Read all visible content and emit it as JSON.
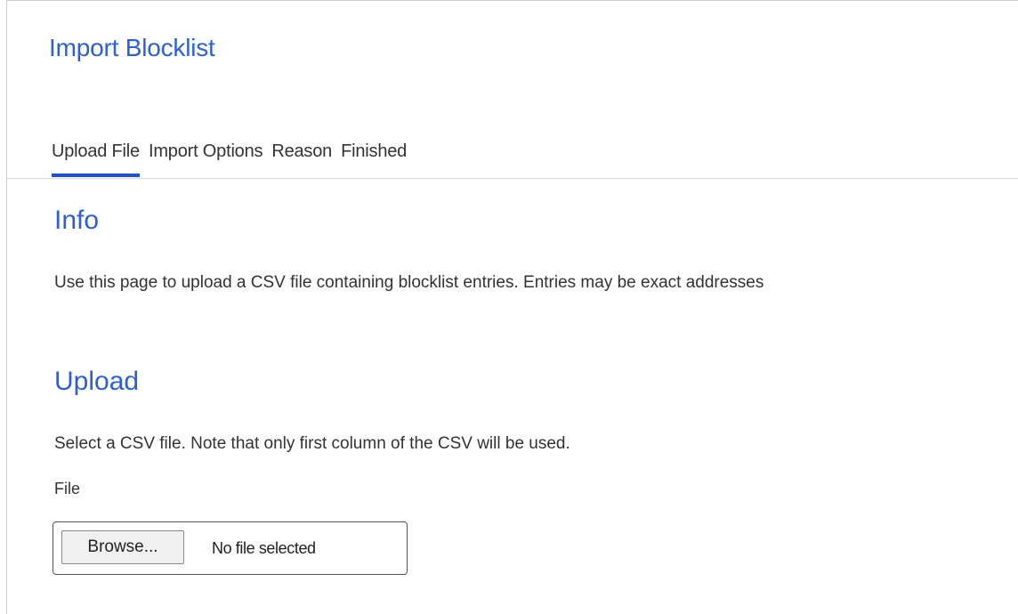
{
  "page": {
    "title": "Import Blocklist"
  },
  "tabs": [
    {
      "label": "Upload File",
      "active": true
    },
    {
      "label": "Import Options",
      "active": false
    },
    {
      "label": "Reason",
      "active": false
    },
    {
      "label": "Finished",
      "active": false
    }
  ],
  "info": {
    "title": "Info",
    "text": "Use this page to upload a CSV file containing blocklist entries. Entries may be exact addresses"
  },
  "upload": {
    "title": "Upload",
    "text": "Select a CSV file. Note that only first column of the CSV will be used.",
    "file_label": "File",
    "browse_label": "Browse...",
    "file_status": "No file selected"
  },
  "colors": {
    "heading": "#2b5fe0",
    "active_tab_underline": "#1a4fe0",
    "text": "#333333"
  }
}
